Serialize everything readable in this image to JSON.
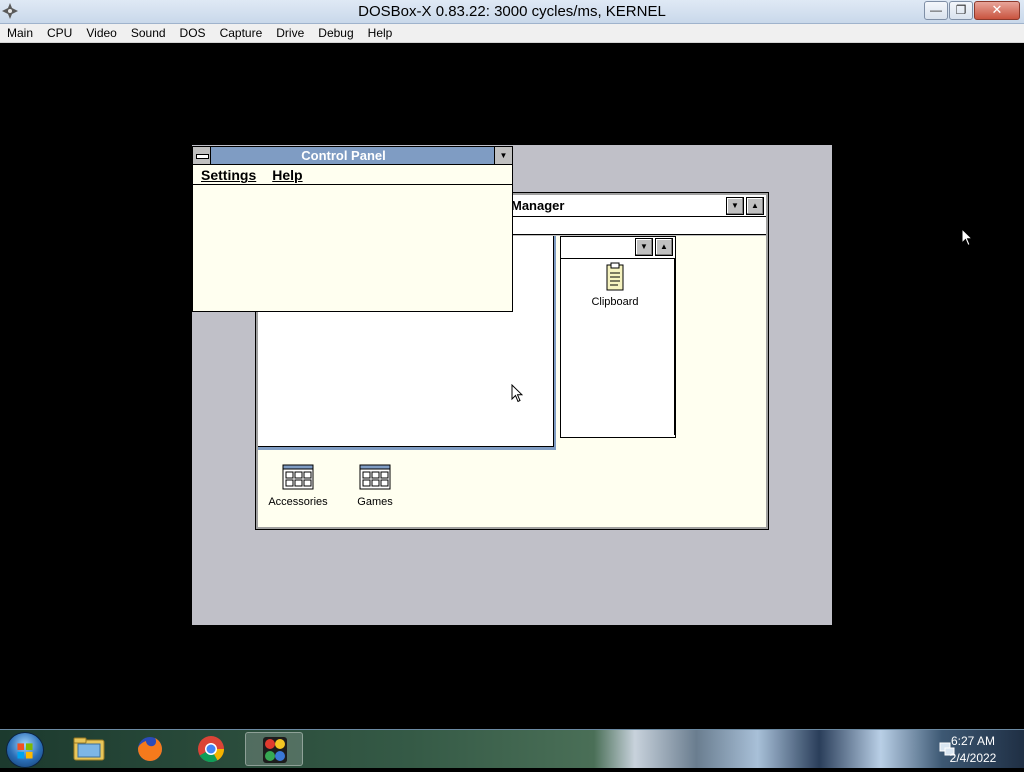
{
  "host_window": {
    "title": "DOSBox-X 0.83.22: 3000 cycles/ms, KERNEL",
    "minimize_glyph": "—",
    "maximize_glyph": "❐",
    "close_glyph": "✕",
    "menus": [
      "Main",
      "CPU",
      "Video",
      "Sound",
      "DOS",
      "Capture",
      "Drive",
      "Debug",
      "Help"
    ]
  },
  "program_manager": {
    "title_visible": "Manager",
    "groups": {
      "main_group_icons": [],
      "sub_group_icons": [
        {
          "label": "Clipboard",
          "icon": "clipboard-icon"
        }
      ],
      "minimized_groups": [
        {
          "label": "Accessories",
          "icon": "program-group-icon"
        },
        {
          "label": "Games",
          "icon": "program-group-icon"
        }
      ]
    }
  },
  "control_panel": {
    "title": "Control Panel",
    "menus": [
      "Settings",
      "Help"
    ]
  },
  "taskbar": {
    "clock_time": "6:27 AM",
    "clock_date": "2/4/2022",
    "pinned": [
      "start-orb",
      "file-explorer-icon",
      "firefox-icon",
      "chrome-icon",
      "dosbox-icon"
    ],
    "active": "dosbox-icon"
  },
  "colors": {
    "win31_active_title": "#7f9cc3",
    "win31_client": "#fffff0",
    "win31_desktop": "#c0c0c8"
  }
}
